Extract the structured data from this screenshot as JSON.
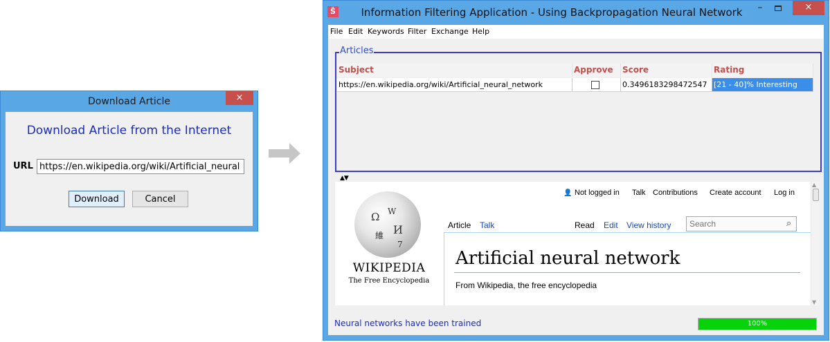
{
  "dialog": {
    "title": "Download Article",
    "close_glyph": "×",
    "heading": "Download Article from the Internet",
    "url_label": "URL",
    "url_value": "https://en.wikipedia.org/wiki/Artificial_neural",
    "download_label": "Download",
    "cancel_label": "Cancel"
  },
  "window": {
    "icon_glyph": "Ŝ",
    "title": "Information Filtering Application - Using Backpropagation Neural Network",
    "min_glyph": "–",
    "close_glyph": "×",
    "menu": [
      "File",
      "Edit",
      "Keywords",
      "Filter",
      "Exchange",
      "Help"
    ],
    "articles_legend": "Articles",
    "columns": [
      "Subject",
      "Approve",
      "Score",
      "Rating"
    ],
    "rows": [
      {
        "subject": "https://en.wikipedia.org/wiki/Artificial_neural_network",
        "approve": false,
        "score": "0.3496183298472547",
        "rating": "[21 - 40]% Interesting"
      }
    ],
    "split_arrows": "▲▼",
    "status": "Neural networks have been trained",
    "progress_text": "100%",
    "progress_fraction": 1.0
  },
  "wiki": {
    "user_glyph": "👤",
    "not_logged_in": "Not logged in",
    "talk_top": "Talk",
    "contributions": "Contributions",
    "create_account": "Create account",
    "log_in": "Log in",
    "logo_name": "WIKIPEDIA",
    "logo_tagline": "The Free Encyclopedia",
    "tab_article": "Article",
    "tab_talk": "Talk",
    "tab_read": "Read",
    "tab_edit": "Edit",
    "tab_history": "View history",
    "search_placeholder": "Search",
    "search_glyph": "⌕",
    "title": "Artificial neural network",
    "from": "From Wikipedia, the free encyclopedia"
  },
  "colors": {
    "accent_blue": "#1c2bbf",
    "header_red": "#c0504d",
    "selection": "#3b8ee8",
    "progress": "#06d30a"
  }
}
